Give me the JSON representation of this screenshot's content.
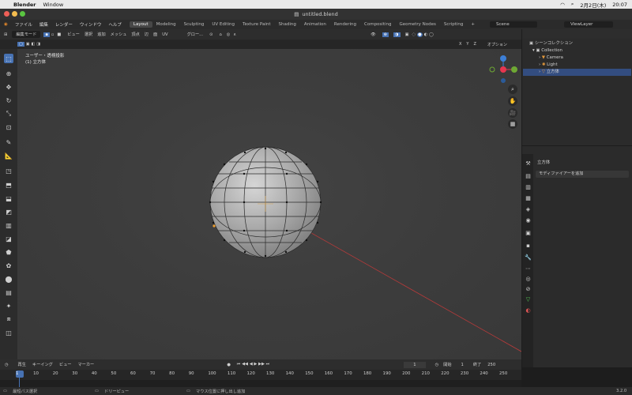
{
  "mac_menubar": {
    "apple": "",
    "app": "Blender",
    "items": [
      "Window"
    ],
    "date": "2月2日(木)",
    "time": "20:07"
  },
  "window": {
    "title": "untitled.blend"
  },
  "topbar": {
    "menus": [
      "ファイル",
      "編集",
      "レンダー",
      "ウィンドウ",
      "ヘルプ"
    ],
    "workspaces": [
      "Layout",
      "Modeling",
      "Sculpting",
      "UV Editing",
      "Texture Paint",
      "Shading",
      "Animation",
      "Rendering",
      "Compositing",
      "Geometry Nodes",
      "Scripting"
    ],
    "active_workspace": "Layout",
    "scene": "Scene",
    "view_layer": "ViewLayer"
  },
  "viewport_header": {
    "mode": "編集モード",
    "menus": [
      "ビュー",
      "選択",
      "追加",
      "メッシュ",
      "頂点",
      "辺",
      "面",
      "UV"
    ],
    "transform": "グロー...",
    "options": "オプション",
    "axes": [
      "X",
      "Y",
      "Z"
    ]
  },
  "viewport": {
    "view_name": "ユーザー・透視投影",
    "object_info": "(1) 立方体"
  },
  "gizmo": {
    "x": "X",
    "y": "Y",
    "z": "Z",
    "x_color": "#e8364f",
    "y_color": "#6ea834",
    "z_color": "#3d7fd6"
  },
  "outliner": {
    "root": "シーンコレクション",
    "collection": "Collection",
    "items": [
      {
        "name": "Camera",
        "color": "#e59a3c"
      },
      {
        "name": "Light",
        "color": "#e59a3c"
      },
      {
        "name": "立方体",
        "color": "#e59a3c",
        "selected": true
      }
    ]
  },
  "properties": {
    "object_name": "立方体",
    "add_modifier": "モディファイアーを追加"
  },
  "timeline": {
    "menus": [
      "再生",
      "キーイング",
      "ビュー",
      "マーカー"
    ],
    "current_frame": "1",
    "start_label": "開始",
    "start": "1",
    "end_label": "終了",
    "end": "250",
    "ruler": [
      "1",
      "10",
      "20",
      "30",
      "40",
      "50",
      "60",
      "70",
      "80",
      "90",
      "100",
      "110",
      "120",
      "130",
      "140",
      "150",
      "160",
      "170",
      "180",
      "190",
      "200",
      "210",
      "220",
      "230",
      "240",
      "250"
    ]
  },
  "statusbar": {
    "left": "最短パス選択",
    "middle": "ドリーピュー",
    "right": "マウス位置に押し出し追加",
    "version": "3.2.0"
  },
  "colors": {
    "accent": "#4772b3",
    "selection": "#334d80"
  }
}
